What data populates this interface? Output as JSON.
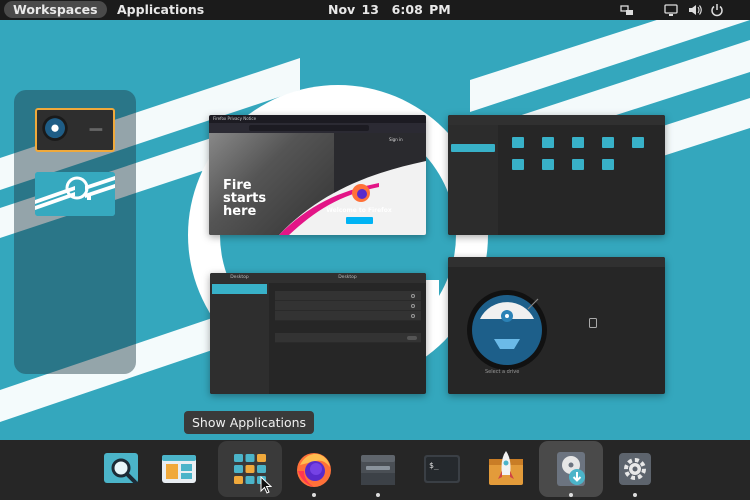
{
  "topbar": {
    "workspaces_label": "Workspaces",
    "applications_label": "Applications",
    "date": "Nov 13",
    "time": "6:08 PM",
    "tray_icons": [
      "network-icon",
      "display-icon",
      "volume-icon",
      "power-icon"
    ]
  },
  "colors": {
    "accent": "#38b1c8",
    "wallpaper": "#34a7bd",
    "selected_workspace_border": "#f0a93b",
    "topbar": "#1b1b1b",
    "dock": "#262626"
  },
  "windows": {
    "firefox": {
      "tab_title": "Firefox Privacy Notice",
      "url": "",
      "headline": [
        "Fire",
        "starts",
        "here"
      ],
      "welcome": "Welcome to Firefox",
      "signin": "Sign in",
      "cta": ""
    },
    "files": {
      "title": "",
      "sidebar": [
        "",
        "",
        "",
        "",
        "",
        "",
        "",
        "",
        "",
        "",
        ""
      ],
      "folders": [
        "",
        "",
        "",
        "",
        "",
        "",
        "",
        "",
        ""
      ]
    },
    "settings": {
      "sidebar_title": "Desktop",
      "title": "Desktop",
      "sidebar": [
        "",
        "",
        "",
        "",
        ""
      ],
      "section_heading": "",
      "options": [
        "",
        "",
        ""
      ],
      "hot_corner_heading": "",
      "hot_corner_option": "",
      "top_bar_heading": ""
    },
    "installer": {
      "title": "",
      "select_label": "Select a drive",
      "device": "",
      "buttons": [
        "",
        ""
      ]
    }
  },
  "tooltip": "Show Applications",
  "dock": {
    "items": [
      {
        "name": "magnifier-app",
        "running": false
      },
      {
        "name": "window-tiling-app",
        "running": false
      },
      {
        "name": "show-applications",
        "running": false
      },
      {
        "name": "firefox",
        "running": true
      },
      {
        "name": "files",
        "running": true
      },
      {
        "name": "terminal",
        "running": false
      },
      {
        "name": "pop-shop",
        "running": false
      },
      {
        "name": "installer",
        "running": true
      },
      {
        "name": "settings",
        "running": true
      }
    ]
  }
}
